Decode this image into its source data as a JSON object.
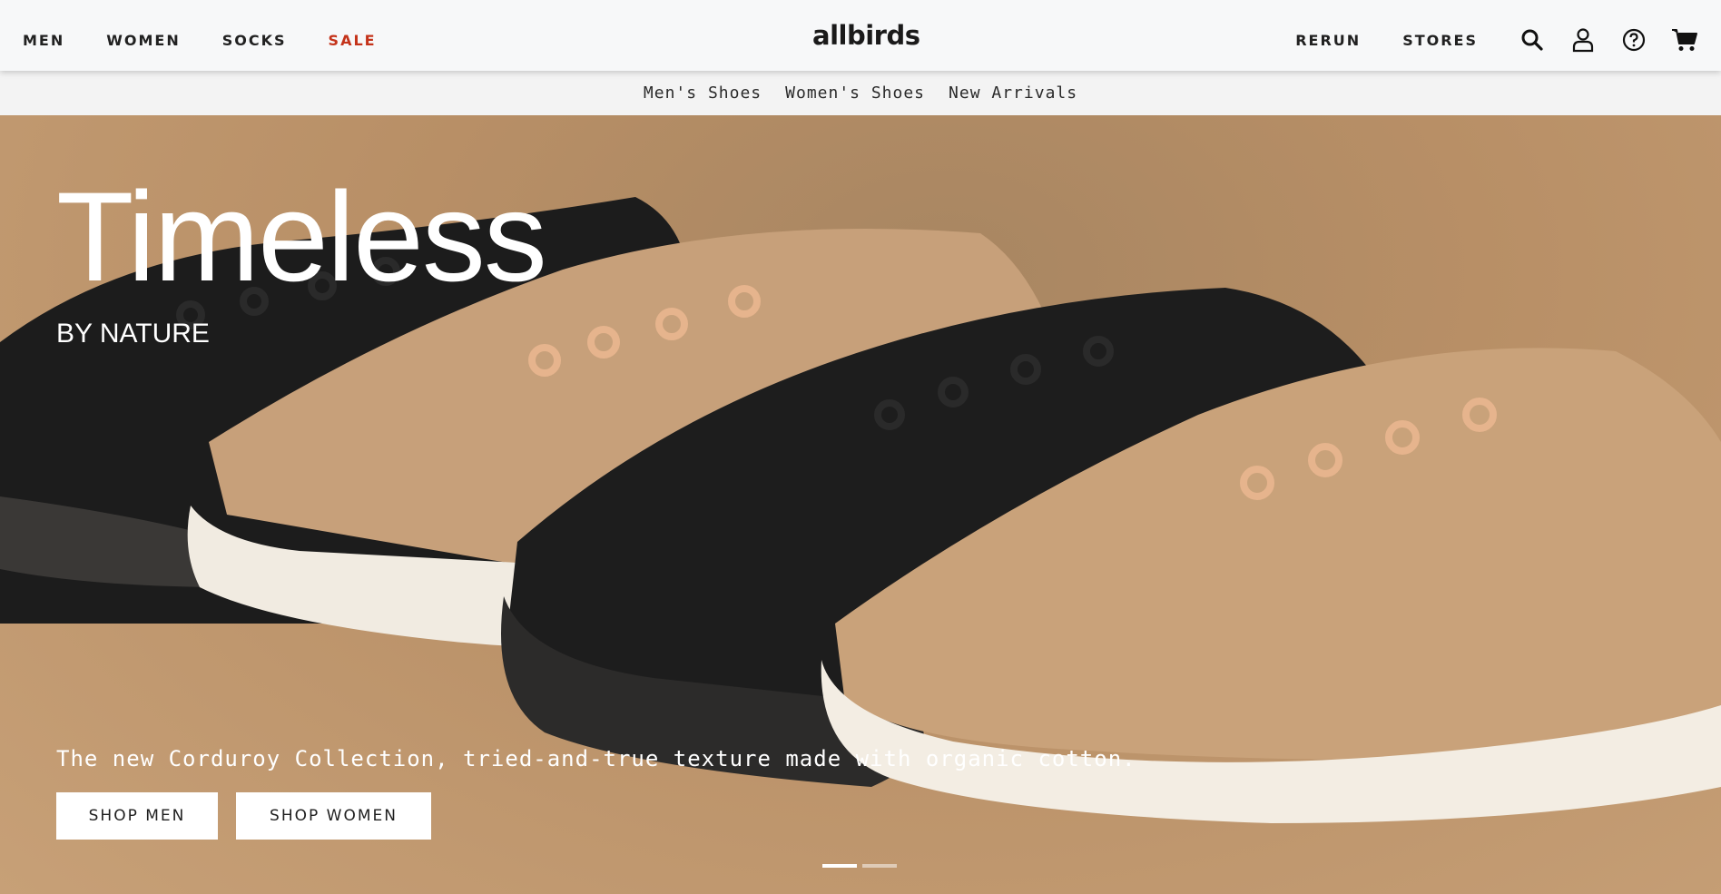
{
  "header": {
    "nav_left": [
      "MEN",
      "WOMEN",
      "SOCKS",
      "SALE"
    ],
    "logo": "allbirds",
    "nav_right": [
      "RERUN",
      "STORES"
    ],
    "icons": [
      "search-icon",
      "account-icon",
      "help-icon",
      "cart-icon"
    ]
  },
  "subnav": [
    "Men's Shoes",
    "Women's Shoes",
    "New Arrivals"
  ],
  "hero": {
    "title": "Timeless",
    "subtitle": "BY NATURE",
    "description": "The new Corduroy Collection, tried-and-true texture made with organic cotton.",
    "buttons": [
      "SHOP MEN",
      "SHOP WOMEN"
    ],
    "slides": {
      "count": 2,
      "active": 1
    }
  },
  "colors": {
    "sale": "#c4331a",
    "header_bg": "#f7f8f9",
    "hero_bg": "#c29a72",
    "tan_shoe": "#c9a27a",
    "black_shoe": "#1e1e1e"
  }
}
